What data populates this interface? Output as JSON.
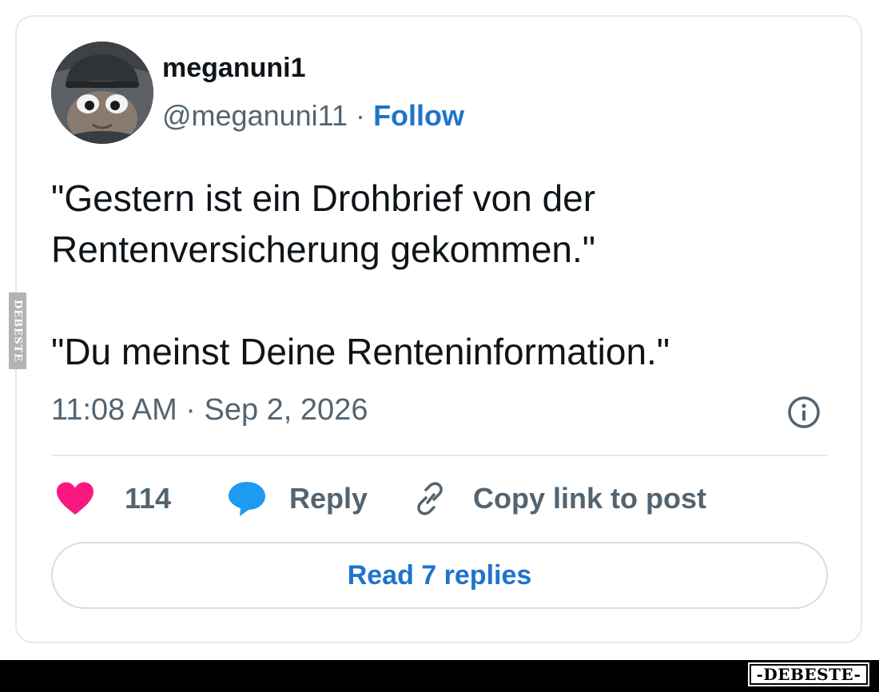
{
  "post": {
    "display_name": "meganuni1",
    "handle": "@meganuni11",
    "separator": "·",
    "follow_label": "Follow",
    "text_line_1": "\"Gestern ist ein Drohbrief von der",
    "text_line_2": "Rentenversicherung gekommen.\"",
    "text_line_3": "\"Du meinst Deine Renteninformation.\"",
    "timestamp": "11:08 AM · Sep 2, 2026",
    "info_icon": "info-circle-icon"
  },
  "actions": {
    "like_count": "114",
    "like_icon": "heart-icon",
    "reply_label": "Reply",
    "reply_icon": "speech-bubble-icon",
    "copy_link_label": "Copy link to post",
    "copy_link_icon": "link-icon"
  },
  "read_replies_label": "Read 7 replies",
  "watermarks": {
    "side": "DEBESTE",
    "bottom": "-DEBESTE-"
  },
  "colors": {
    "link_blue": "#1d74cc",
    "heart_pink": "#f91880",
    "bubble_blue": "#1d9bf0",
    "muted_gray": "#536471",
    "border": "#e6e9ec"
  }
}
